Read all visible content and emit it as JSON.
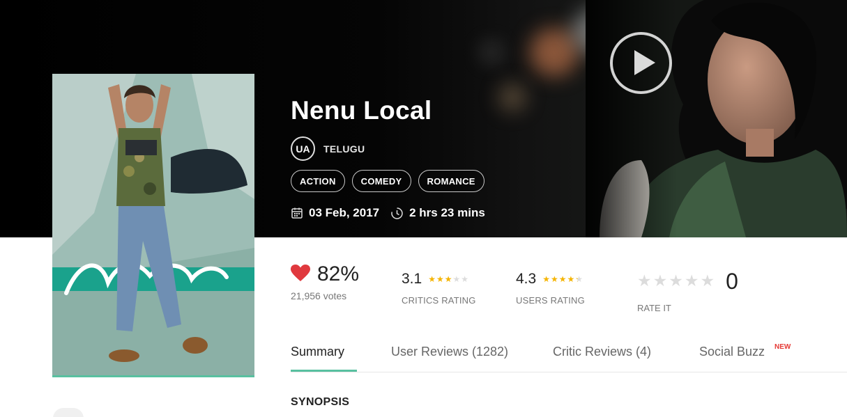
{
  "movie": {
    "title": "Nenu Local",
    "certificate": "UA",
    "language": "TELUGU",
    "genres": [
      "ACTION",
      "COMEDY",
      "ROMANCE"
    ],
    "release_date": "03 Feb, 2017",
    "duration": "2 hrs 23 mins"
  },
  "ratings": {
    "audience_percent": "82%",
    "votes": "21,956 votes",
    "critics": {
      "value": "3.1",
      "stars": 3.1,
      "label": "CRITICS RATING"
    },
    "users": {
      "value": "4.3",
      "stars": 4.3,
      "label": "USERS RATING"
    },
    "rate_it": {
      "count": "0",
      "label": "RATE IT",
      "stars": 5
    }
  },
  "tabs": [
    {
      "label": "Summary",
      "active": true
    },
    {
      "label": "User Reviews (1282)",
      "active": false
    },
    {
      "label": "Critic Reviews (4)",
      "active": false
    },
    {
      "label": "Social Buzz",
      "active": false,
      "badge": "NEW"
    }
  ],
  "section_heading": "SYNOPSIS",
  "icons": {
    "play": "play-icon",
    "calendar": "calendar-icon",
    "clock": "clock-icon",
    "heart": "heart-icon",
    "star": "star-icon"
  },
  "colors": {
    "accent": "#58c0a0",
    "heart": "#e0393e",
    "star_filled": "#f5b400",
    "star_empty": "#dcdcdc",
    "new_badge": "#e53935"
  }
}
